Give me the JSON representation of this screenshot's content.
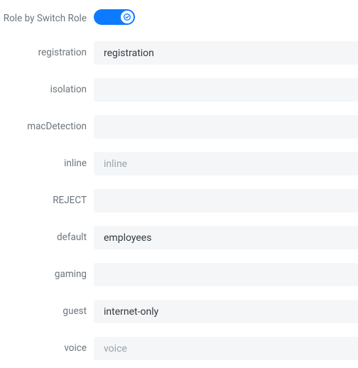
{
  "header": {
    "toggle_label": "Role by Switch Role",
    "toggle_on": true
  },
  "fields": [
    {
      "key": "registration",
      "label": "registration",
      "value": "registration",
      "placeholder": ""
    },
    {
      "key": "isolation",
      "label": "isolation",
      "value": "",
      "placeholder": ""
    },
    {
      "key": "macDetection",
      "label": "macDetection",
      "value": "",
      "placeholder": ""
    },
    {
      "key": "inline",
      "label": "inline",
      "value": "",
      "placeholder": "inline"
    },
    {
      "key": "reject",
      "label": "REJECT",
      "value": "",
      "placeholder": ""
    },
    {
      "key": "default",
      "label": "default",
      "value": "employees",
      "placeholder": ""
    },
    {
      "key": "gaming",
      "label": "gaming",
      "value": "",
      "placeholder": ""
    },
    {
      "key": "guest",
      "label": "guest",
      "value": "internet-only",
      "placeholder": ""
    },
    {
      "key": "voice",
      "label": "voice",
      "value": "",
      "placeholder": "voice"
    }
  ],
  "colors": {
    "accent": "#0d7bff",
    "input_bg": "#f4f6f8",
    "label": "#6c757d",
    "text": "#343a40",
    "placeholder": "#9aa3ab"
  }
}
